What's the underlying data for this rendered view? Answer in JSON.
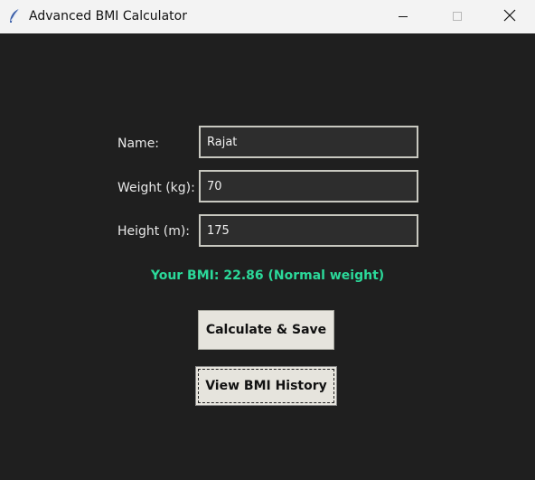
{
  "window": {
    "title": "Advanced BMI Calculator",
    "app_icon": "feather-icon"
  },
  "titlebar_controls": {
    "minimize_icon": "minimize-icon",
    "maximize_icon": "maximize-icon",
    "close_icon": "close-icon"
  },
  "form": {
    "name_label": "Name:",
    "name_value": "Rajat",
    "weight_label": "Weight (kg):",
    "weight_value": "70",
    "height_label": "Height (m):",
    "height_value": "175"
  },
  "result": {
    "text": "Your BMI: 22.86 (Normal weight)",
    "color": "#2bd99a"
  },
  "buttons": {
    "calculate_label": "Calculate & Save",
    "history_label": "View BMI History"
  },
  "colors": {
    "background": "#1f1f1f",
    "entry_background": "#2d2d2d",
    "button_background": "#e6e4dd"
  }
}
